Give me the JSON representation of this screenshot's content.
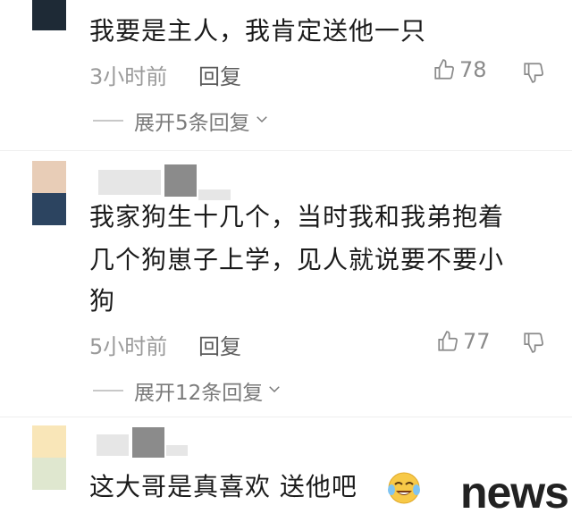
{
  "comments": [
    {
      "text_lines": [
        "我要是主人，我肯定送他一只"
      ],
      "time": "3小时前",
      "reply": "回复",
      "likes": "78",
      "expand": "展开5条回复",
      "avatar_colors": [
        "#1e2a36"
      ]
    },
    {
      "text_lines": [
        "我家狗生十几个，当时我和我弟抱着",
        "几个狗崽子上学，见人就说要不要小",
        "狗"
      ],
      "time": "5小时前",
      "reply": "回复",
      "likes": "77",
      "expand": "展开12条回复",
      "avatar_colors": [
        "#e8cdb7",
        "#2c4460"
      ]
    },
    {
      "text_lines": [
        "这大哥是真喜欢  送他吧"
      ],
      "avatar_colors": [
        "#f9e6b8",
        "#dfe7cf"
      ]
    }
  ],
  "watermark": "news",
  "icons": {
    "like": "thumbs-up-icon",
    "dislike": "thumbs-down-icon",
    "chevron": "chevron-down-icon",
    "emoji": "tears-of-joy-emoji-icon"
  }
}
